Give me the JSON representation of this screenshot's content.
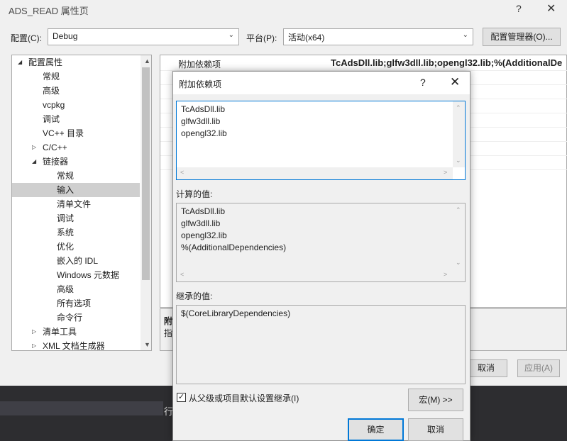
{
  "window": {
    "title": "ADS_READ 属性页",
    "help": "?",
    "close": "✕"
  },
  "config": {
    "config_label": "配置(C):",
    "config_value": "Debug",
    "platform_label": "平台(P):",
    "platform_value": "活动(x64)",
    "manager_button": "配置管理器(O)..."
  },
  "tree": {
    "items": [
      {
        "label": "配置属性",
        "expand": "expanded"
      },
      {
        "label": "常规"
      },
      {
        "label": "高级"
      },
      {
        "label": "vcpkg"
      },
      {
        "label": "调试"
      },
      {
        "label": "VC++ 目录"
      },
      {
        "label": "C/C++",
        "expand": "collapsed"
      },
      {
        "label": "链接器",
        "expand": "expanded"
      },
      {
        "label": "常规"
      },
      {
        "label": "输入",
        "selected": true
      },
      {
        "label": "清单文件"
      },
      {
        "label": "调试"
      },
      {
        "label": "系统"
      },
      {
        "label": "优化"
      },
      {
        "label": "嵌入的 IDL"
      },
      {
        "label": "Windows 元数据"
      },
      {
        "label": "高级"
      },
      {
        "label": "所有选项"
      },
      {
        "label": "命令行"
      },
      {
        "label": "清单工具",
        "expand": "collapsed"
      },
      {
        "label": "XML 文档生成器",
        "expand": "collapsed"
      }
    ]
  },
  "grid": {
    "row1_name": "附加依赖项",
    "row1_value": "TcAdsDll.lib;glfw3dll.lib;opengl32.lib;%(AdditionalDe"
  },
  "desc": {
    "title": "附",
    "text": "指"
  },
  "buttons": {
    "cancel": "取消",
    "apply": "应用(A)"
  },
  "ide": {
    "text": "行"
  },
  "dialog": {
    "title": "附加依赖项",
    "help": "?",
    "close": "✕",
    "edit_lines": "TcAdsDll.lib\nglfw3dll.lib\nopengl32.lib",
    "computed_label": "计算的值:",
    "computed_lines": "TcAdsDll.lib\nglfw3dll.lib\nopengl32.lib\n%(AdditionalDependencies)",
    "inherited_label": "继承的值:",
    "inherited_lines": "$(CoreLibraryDependencies)",
    "inherit_checkbox": "从父级或项目默认设置继承(I)",
    "inherit_checked": true,
    "macro_button": "宏(M) >>",
    "ok": "确定",
    "cancel": "取消"
  }
}
